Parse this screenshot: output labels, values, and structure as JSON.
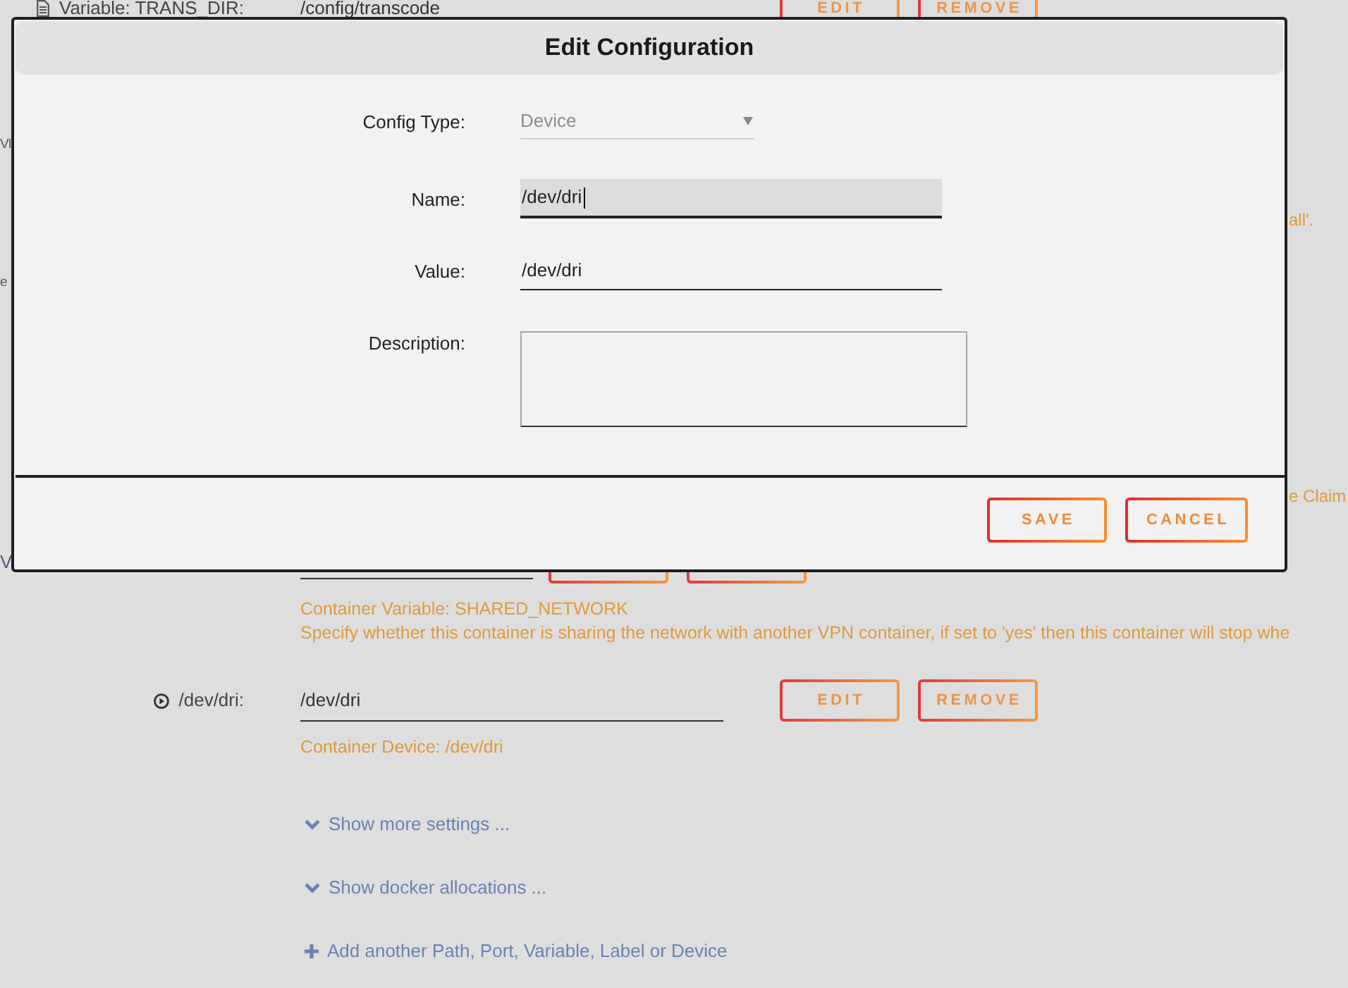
{
  "settings": [
    {
      "kind": "variable",
      "label": "Variable: TRANS_DIR:",
      "value": "/config/transcode",
      "buttons": [
        "EDIT",
        "REMOVE"
      ]
    },
    {
      "kind": "left_fragment",
      "text": "VI"
    },
    {
      "kind": "right_fragment",
      "text": "all'."
    },
    {
      "kind": "left_fragment",
      "text": "e"
    },
    {
      "kind": "right_fragment",
      "text": "e Claim"
    },
    {
      "kind": "covered_row",
      "label": "V",
      "notes": [
        "Container Variable: SHARED_NETWORK",
        "Specify whether this container is sharing the network with another VPN container, if set to 'yes' then this container will stop whe"
      ]
    },
    {
      "kind": "device",
      "label": "/dev/dri:",
      "value": "/dev/dri",
      "buttons": [
        "EDIT",
        "REMOVE"
      ],
      "notes": [
        "Container Device: /dev/dri"
      ]
    }
  ],
  "links": [
    {
      "kind": "expand",
      "text": "Show more settings ..."
    },
    {
      "kind": "expand",
      "text": "Show docker allocations ..."
    },
    {
      "kind": "add",
      "text": "Add another Path, Port, Variable, Label or Device"
    }
  ],
  "dialog": {
    "title": "Edit Configuration",
    "fields": [
      {
        "kind": "select",
        "label": "Config Type:",
        "value": "Device",
        "disabled": true
      },
      {
        "kind": "input",
        "label": "Name:",
        "value": "/dev/dri",
        "focused": true
      },
      {
        "kind": "input",
        "label": "Value:",
        "value": "/dev/dri",
        "focused": false
      },
      {
        "kind": "textarea",
        "label": "Description:"
      }
    ],
    "buttons": [
      "SAVE",
      "CANCEL"
    ]
  }
}
